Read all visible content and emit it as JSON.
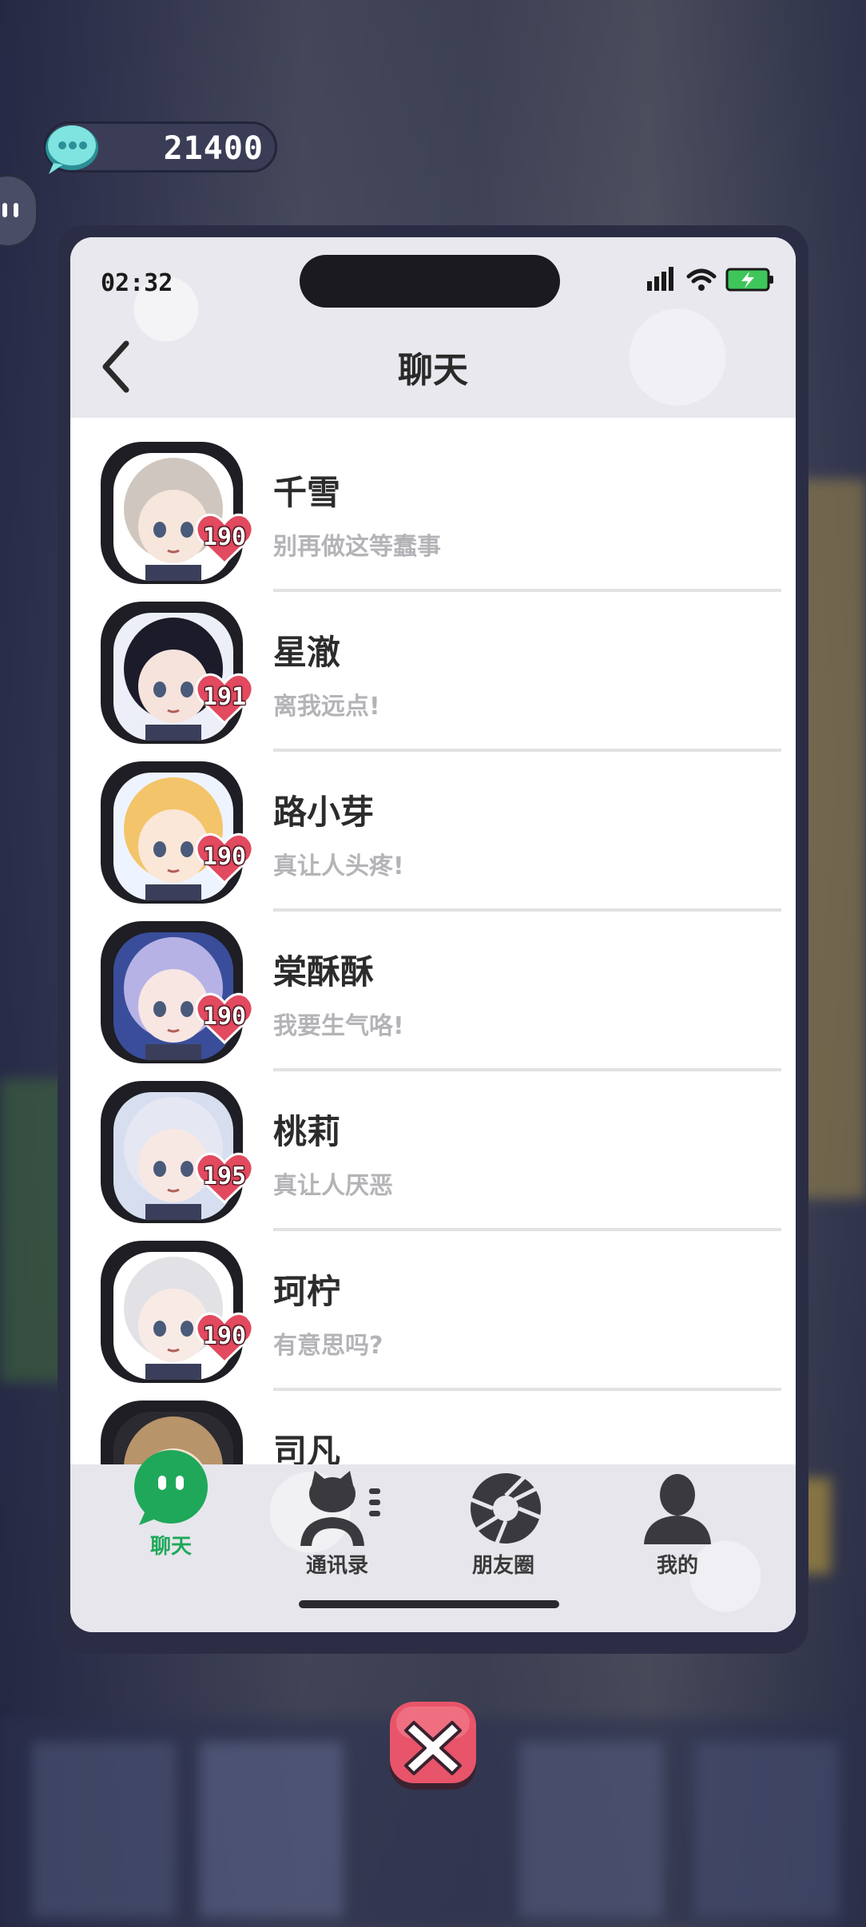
{
  "currency": {
    "amount": "21400",
    "icon": "chat-bubble-coin-icon"
  },
  "phone": {
    "status_time": "02:32",
    "title": "聊天"
  },
  "chats": [
    {
      "name": "千雪",
      "message": "别再做这等蠢事",
      "affection": "190",
      "hair": "#cfc7bf",
      "skin": "#f6e6dc",
      "bg": "#ffffff"
    },
    {
      "name": "星澈",
      "message": "离我远点!",
      "affection": "191",
      "hair": "#1c1b2a",
      "skin": "#f6e3dc",
      "bg": "#eceff8"
    },
    {
      "name": "路小芽",
      "message": "真让人头疼!",
      "affection": "190",
      "hair": "#f4c46a",
      "skin": "#fbe7d8",
      "bg": "#eef4ff"
    },
    {
      "name": "棠酥酥",
      "message": "我要生气咯!",
      "affection": "190",
      "hair": "#b6b2e6",
      "skin": "#f7e6e2",
      "bg": "#3a4d9a"
    },
    {
      "name": "桃莉",
      "message": "真让人厌恶",
      "affection": "195",
      "hair": "#e5e7f3",
      "skin": "#f8e8e4",
      "bg": "#d6def0"
    },
    {
      "name": "珂柠",
      "message": "有意思吗?",
      "affection": "190",
      "hair": "#e2e2e6",
      "skin": "#f8ebe6",
      "bg": "#ffffff"
    },
    {
      "name": "司凡",
      "message": "",
      "affection": "",
      "hair": "#b8946a",
      "skin": "#f4e2d2",
      "bg": "#2a2a30"
    }
  ],
  "tabs": [
    {
      "label": "聊天",
      "icon": "chat-bubble-icon",
      "active": true
    },
    {
      "label": "通讯录",
      "icon": "contacts-cat-icon",
      "active": false
    },
    {
      "label": "朋友圈",
      "icon": "camera-shutter-icon",
      "active": false
    },
    {
      "label": "我的",
      "icon": "user-profile-icon",
      "active": false
    }
  ],
  "colors": {
    "active_green": "#1fa85a",
    "heart_red": "#e24a5f",
    "close_red": "#e8546a"
  }
}
